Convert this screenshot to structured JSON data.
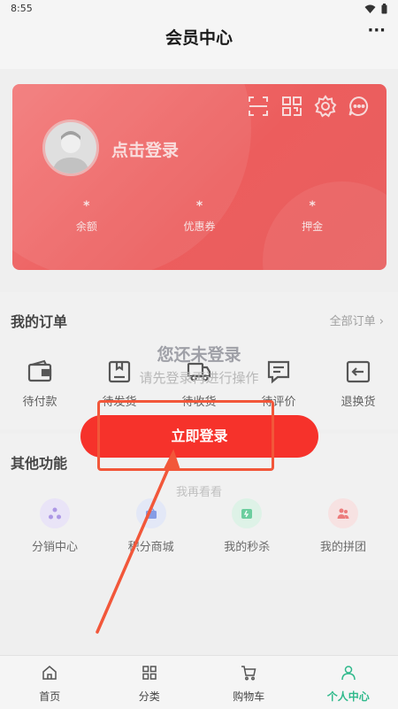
{
  "status_bar": {
    "time": "8:55"
  },
  "header": {
    "title": "会员中心",
    "more_icon": "more-dots-icon"
  },
  "card": {
    "login_prompt": "点击登录",
    "stats": [
      {
        "value": "*",
        "label": "余额"
      },
      {
        "value": "*",
        "label": "优惠券"
      },
      {
        "value": "*",
        "label": "押金"
      }
    ],
    "icons": [
      "scan-icon",
      "qrcode-icon",
      "settings-icon",
      "message-icon"
    ]
  },
  "orders": {
    "title": "我的订单",
    "all_link": "全部订单 ›",
    "items": [
      {
        "label": "待付款",
        "icon": "wallet-icon"
      },
      {
        "label": "待发货",
        "icon": "box-icon"
      },
      {
        "label": "待收货",
        "icon": "truck-icon"
      },
      {
        "label": "待评价",
        "icon": "comment-icon"
      },
      {
        "label": "退换货",
        "icon": "return-icon"
      }
    ]
  },
  "other": {
    "title": "其他功能",
    "items": [
      {
        "label": "分销中心",
        "icon": "distribution-icon",
        "color": "#9b82e0"
      },
      {
        "label": "积分商城",
        "icon": "points-mall-icon",
        "color": "#6b87e0"
      },
      {
        "label": "我的秒杀",
        "icon": "flash-sale-icon",
        "color": "#4cc48a"
      },
      {
        "label": "我的拼团",
        "icon": "group-buy-icon",
        "color": "#e86060"
      }
    ]
  },
  "login_prompt": {
    "title": "您还未登录",
    "subtitle": "请先登录再进行操作",
    "button": "立即登录",
    "browse": "我再看看"
  },
  "tabbar": {
    "items": [
      {
        "label": "首页",
        "icon": "home-icon"
      },
      {
        "label": "分类",
        "icon": "category-icon"
      },
      {
        "label": "购物车",
        "icon": "cart-icon"
      },
      {
        "label": "个人中心",
        "icon": "user-icon",
        "active": true
      }
    ]
  },
  "colors": {
    "brand_red": "#f6322b",
    "active_tab": "#2fb98b"
  }
}
